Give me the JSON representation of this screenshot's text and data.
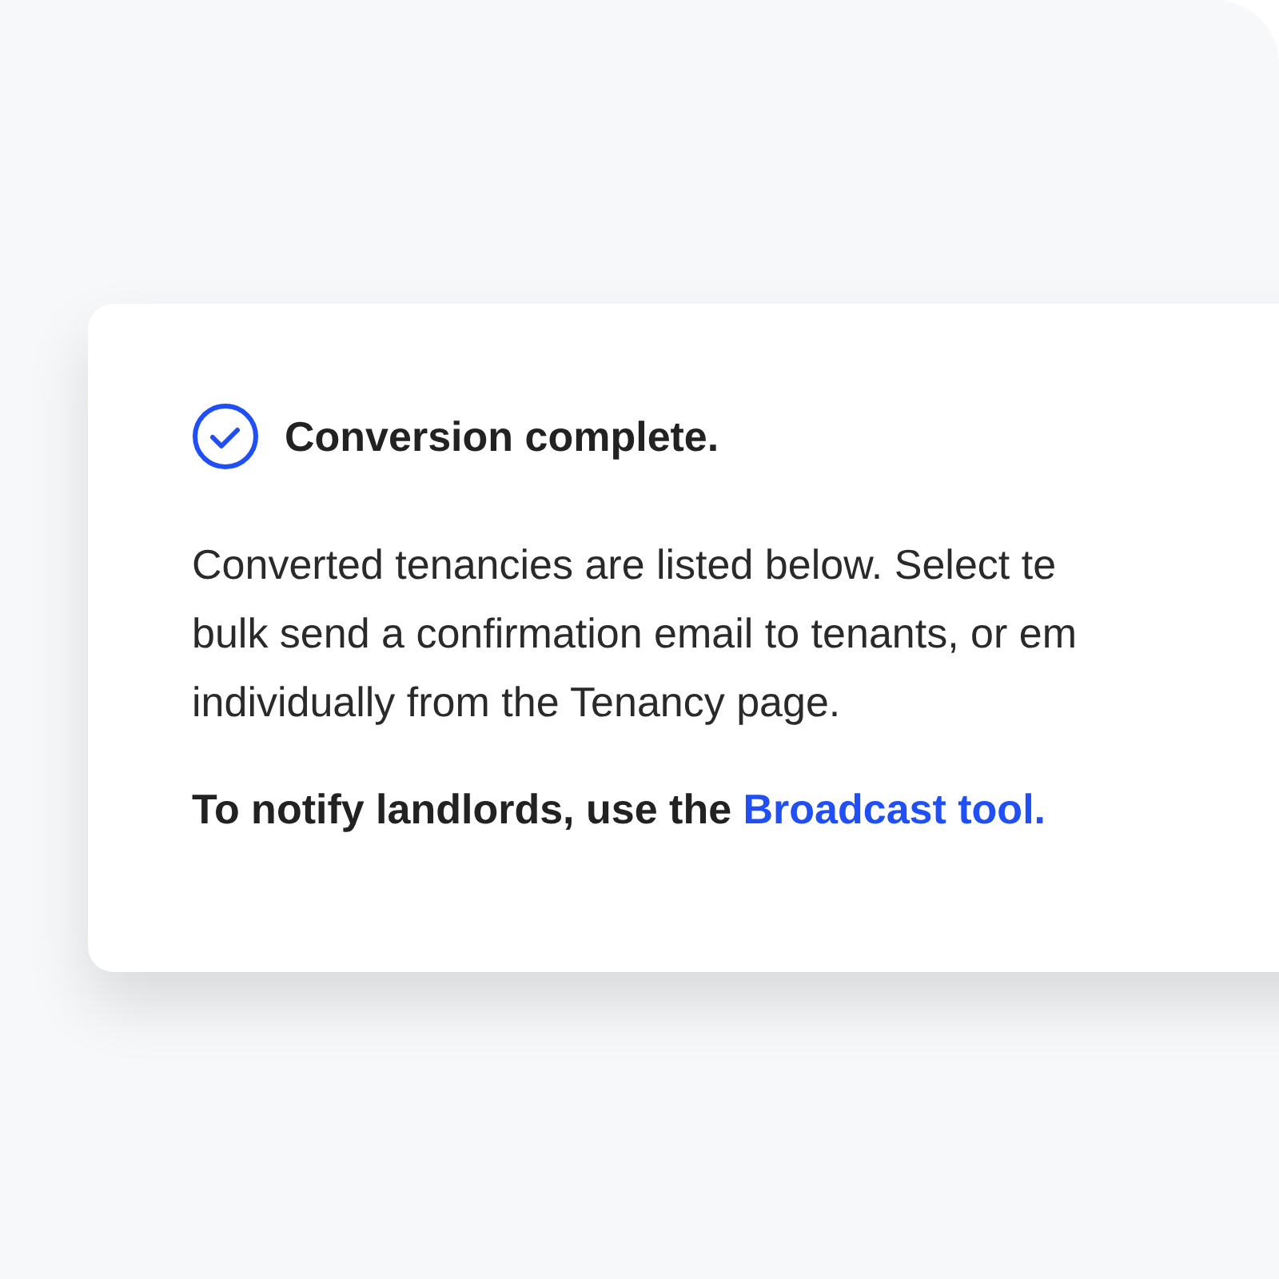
{
  "alert": {
    "title": "Conversion complete.",
    "body_lines": [
      "Converted tenancies are listed below. Select te",
      "bulk send a confirmation email to tenants, or em",
      "individually from the Tenancy page."
    ],
    "note": "To notify landlords, use the ",
    "link": "Broadcast tool."
  }
}
